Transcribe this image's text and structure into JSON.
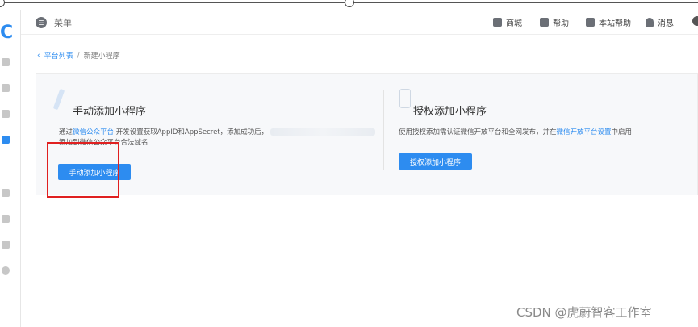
{
  "topbar": {
    "menu_label": "菜单",
    "items": [
      {
        "label": "商城",
        "icon": "store-icon"
      },
      {
        "label": "帮助",
        "icon": "help-icon"
      },
      {
        "label": "本站帮助",
        "icon": "site-help-icon"
      },
      {
        "label": "消息",
        "icon": "bell-icon"
      }
    ]
  },
  "breadcrumb": {
    "back_label": "平台列表",
    "separator": "/",
    "current": "新建小程序"
  },
  "manual_card": {
    "title": "手动添加小程序",
    "desc_prefix": "通过",
    "desc_link": "微信公众平台",
    "desc_middle": "开发设置获取AppID和AppSecret，添加成功后，",
    "desc_line2": "添加到微信公众平台合法域名",
    "button_label": "手动添加小程序"
  },
  "auth_card": {
    "title": "授权添加小程序",
    "desc_prefix": "使用授权添加需认证微信开放平台和全网发布，并在",
    "desc_link": "微信开放平台设置",
    "desc_suffix": "中启用",
    "button_label": "授权添加小程序"
  },
  "watermark": "CSDN @虎蔚智客工作室",
  "colors": {
    "accent": "#2d8cf0",
    "highlight": "#e02020",
    "panel_bg": "#f7f8fa"
  }
}
